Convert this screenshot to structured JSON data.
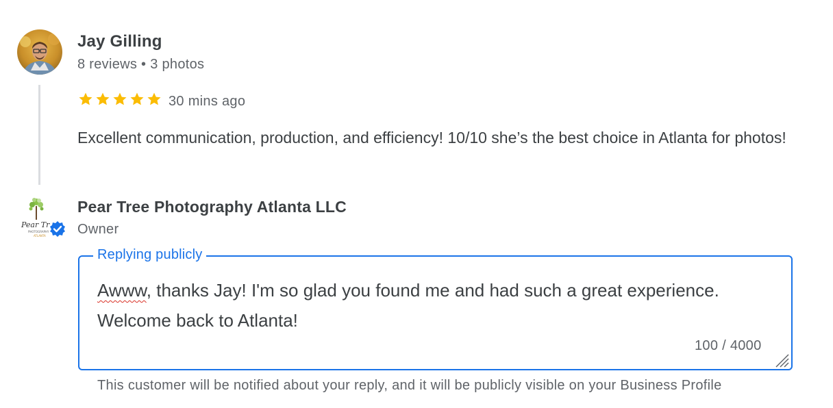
{
  "review": {
    "reviewer_name": "Jay Gilling",
    "reviewer_meta": "8 reviews • 3 photos",
    "rating": 5,
    "rating_max": 5,
    "time": "30 mins ago",
    "text": "Excellent communication, production, and efficiency! 10/10 she’s the best choice in Atlanta for photos!"
  },
  "owner": {
    "name": "Pear Tree Photography Atlanta LLC",
    "role": "Owner",
    "logo_text": {
      "line1": "Pear Tr",
      "line2": "PHOTOGRAPHY",
      "line3": "ATLANTA"
    },
    "verified_icon": "verified-badge-icon"
  },
  "reply": {
    "label": "Replying publicly",
    "text_misspelled": "Awww",
    "text_rest": ", thanks Jay! I'm so glad you found me and had such a great experience. Welcome back to Atlanta!",
    "char_count": "100 / 4000"
  },
  "helper_text": "This customer will be notified about your reply, and it will be publicly visible on your Business Profile",
  "colors": {
    "accent": "#1a73e8",
    "star": "#fbbc04",
    "text": "#3c4043",
    "secondary": "#5f6368",
    "spellcheck": "#d93025"
  }
}
